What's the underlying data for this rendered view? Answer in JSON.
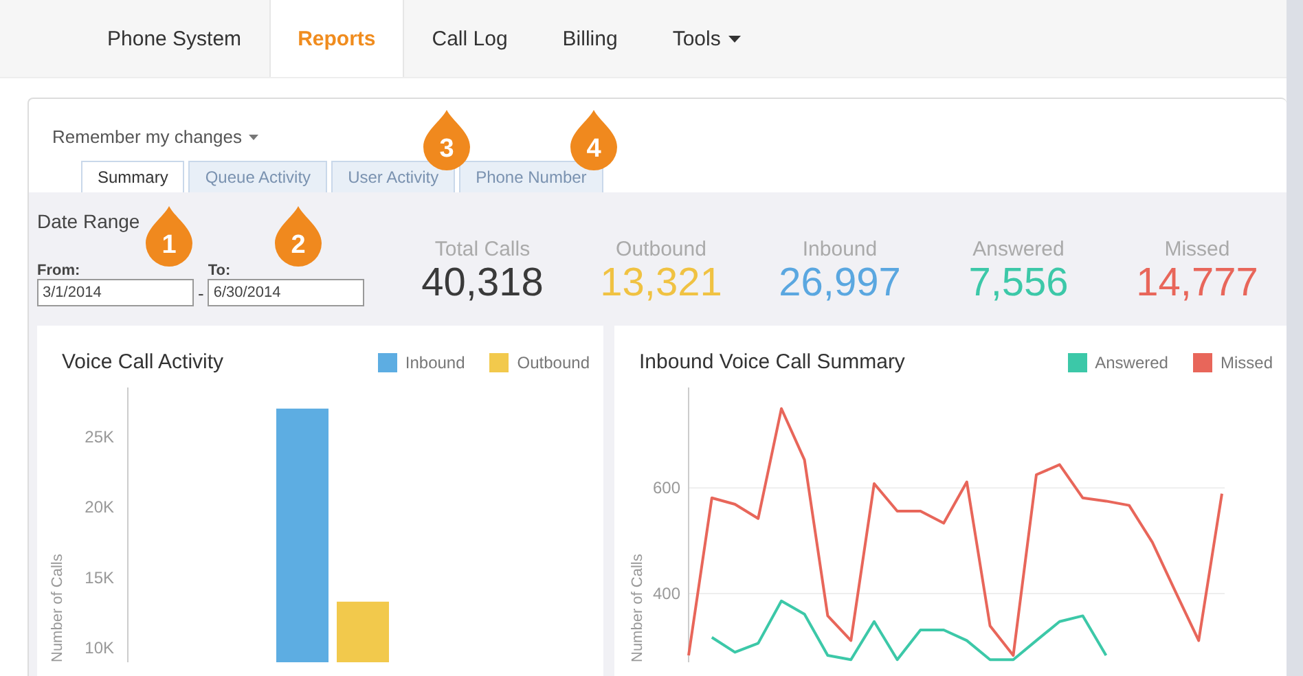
{
  "nav": {
    "items": [
      {
        "label": "Phone System",
        "selected": false,
        "dropdown": false
      },
      {
        "label": "Reports",
        "selected": true,
        "dropdown": false
      },
      {
        "label": "Call Log",
        "selected": false,
        "dropdown": false
      },
      {
        "label": "Billing",
        "selected": false,
        "dropdown": false
      },
      {
        "label": "Tools",
        "selected": false,
        "dropdown": true
      }
    ]
  },
  "remember": "Remember my changes",
  "tabs": [
    {
      "label": "Summary",
      "selected": true
    },
    {
      "label": "Queue Activity",
      "selected": false
    },
    {
      "label": "User Activity",
      "selected": false
    },
    {
      "label": "Phone Number",
      "selected": false
    }
  ],
  "date_range": {
    "title": "Date Range",
    "from_label": "From:",
    "from_value": "3/1/2014",
    "separator": "-",
    "to_label": "To:",
    "to_value": "6/30/2014"
  },
  "stats": [
    {
      "label": "Total Calls",
      "value": "40,318",
      "color": "#3a3a3a"
    },
    {
      "label": "Outbound",
      "value": "13,321",
      "color": "#f0c242"
    },
    {
      "label": "Inbound",
      "value": "26,997",
      "color": "#5aa7e0"
    },
    {
      "label": "Answered",
      "value": "7,556",
      "color": "#3cc8a8"
    },
    {
      "label": "Missed",
      "value": "14,777",
      "color": "#e8665a"
    }
  ],
  "voice_chart": {
    "title": "Voice Call Activity",
    "chart_data": {
      "type": "bar",
      "ylabel": "Number of Calls",
      "categories": [
        null
      ],
      "series": [
        {
          "name": "Inbound",
          "color": "#5dade2",
          "values": [
            27000
          ]
        },
        {
          "name": "Outbound",
          "color": "#f2c94c",
          "values": [
            13300
          ]
        }
      ],
      "ylim": [
        9000,
        28500
      ],
      "yticks": [
        {
          "value": 10000,
          "label": "10K"
        },
        {
          "value": 15000,
          "label": "15K"
        },
        {
          "value": 20000,
          "label": "20K"
        },
        {
          "value": 25000,
          "label": "25K"
        }
      ]
    }
  },
  "summary_chart": {
    "title": "Inbound Voice Call Summary",
    "chart_data": {
      "type": "line",
      "ylabel": "Number of Calls",
      "series": [
        {
          "name": "Answered",
          "color": "#3cc8a8",
          "values": [
            null,
            317,
            289,
            306,
            386,
            361,
            283,
            275,
            347,
            275,
            331,
            331,
            311,
            275,
            275,
            311,
            347,
            358,
            283,
            null,
            null,
            null,
            null,
            null
          ]
        },
        {
          "name": "Missed",
          "color": "#e8665a",
          "values": [
            283,
            581,
            569,
            542,
            750,
            653,
            358,
            311,
            608,
            556,
            556,
            533,
            611,
            339,
            283,
            625,
            644,
            581,
            575,
            567,
            497,
            403,
            311,
            589
          ]
        }
      ],
      "ylim": [
        270,
        790
      ],
      "yticks": [
        400,
        600
      ]
    }
  },
  "callouts": [
    {
      "number": "1"
    },
    {
      "number": "2"
    },
    {
      "number": "3"
    },
    {
      "number": "4"
    }
  ]
}
